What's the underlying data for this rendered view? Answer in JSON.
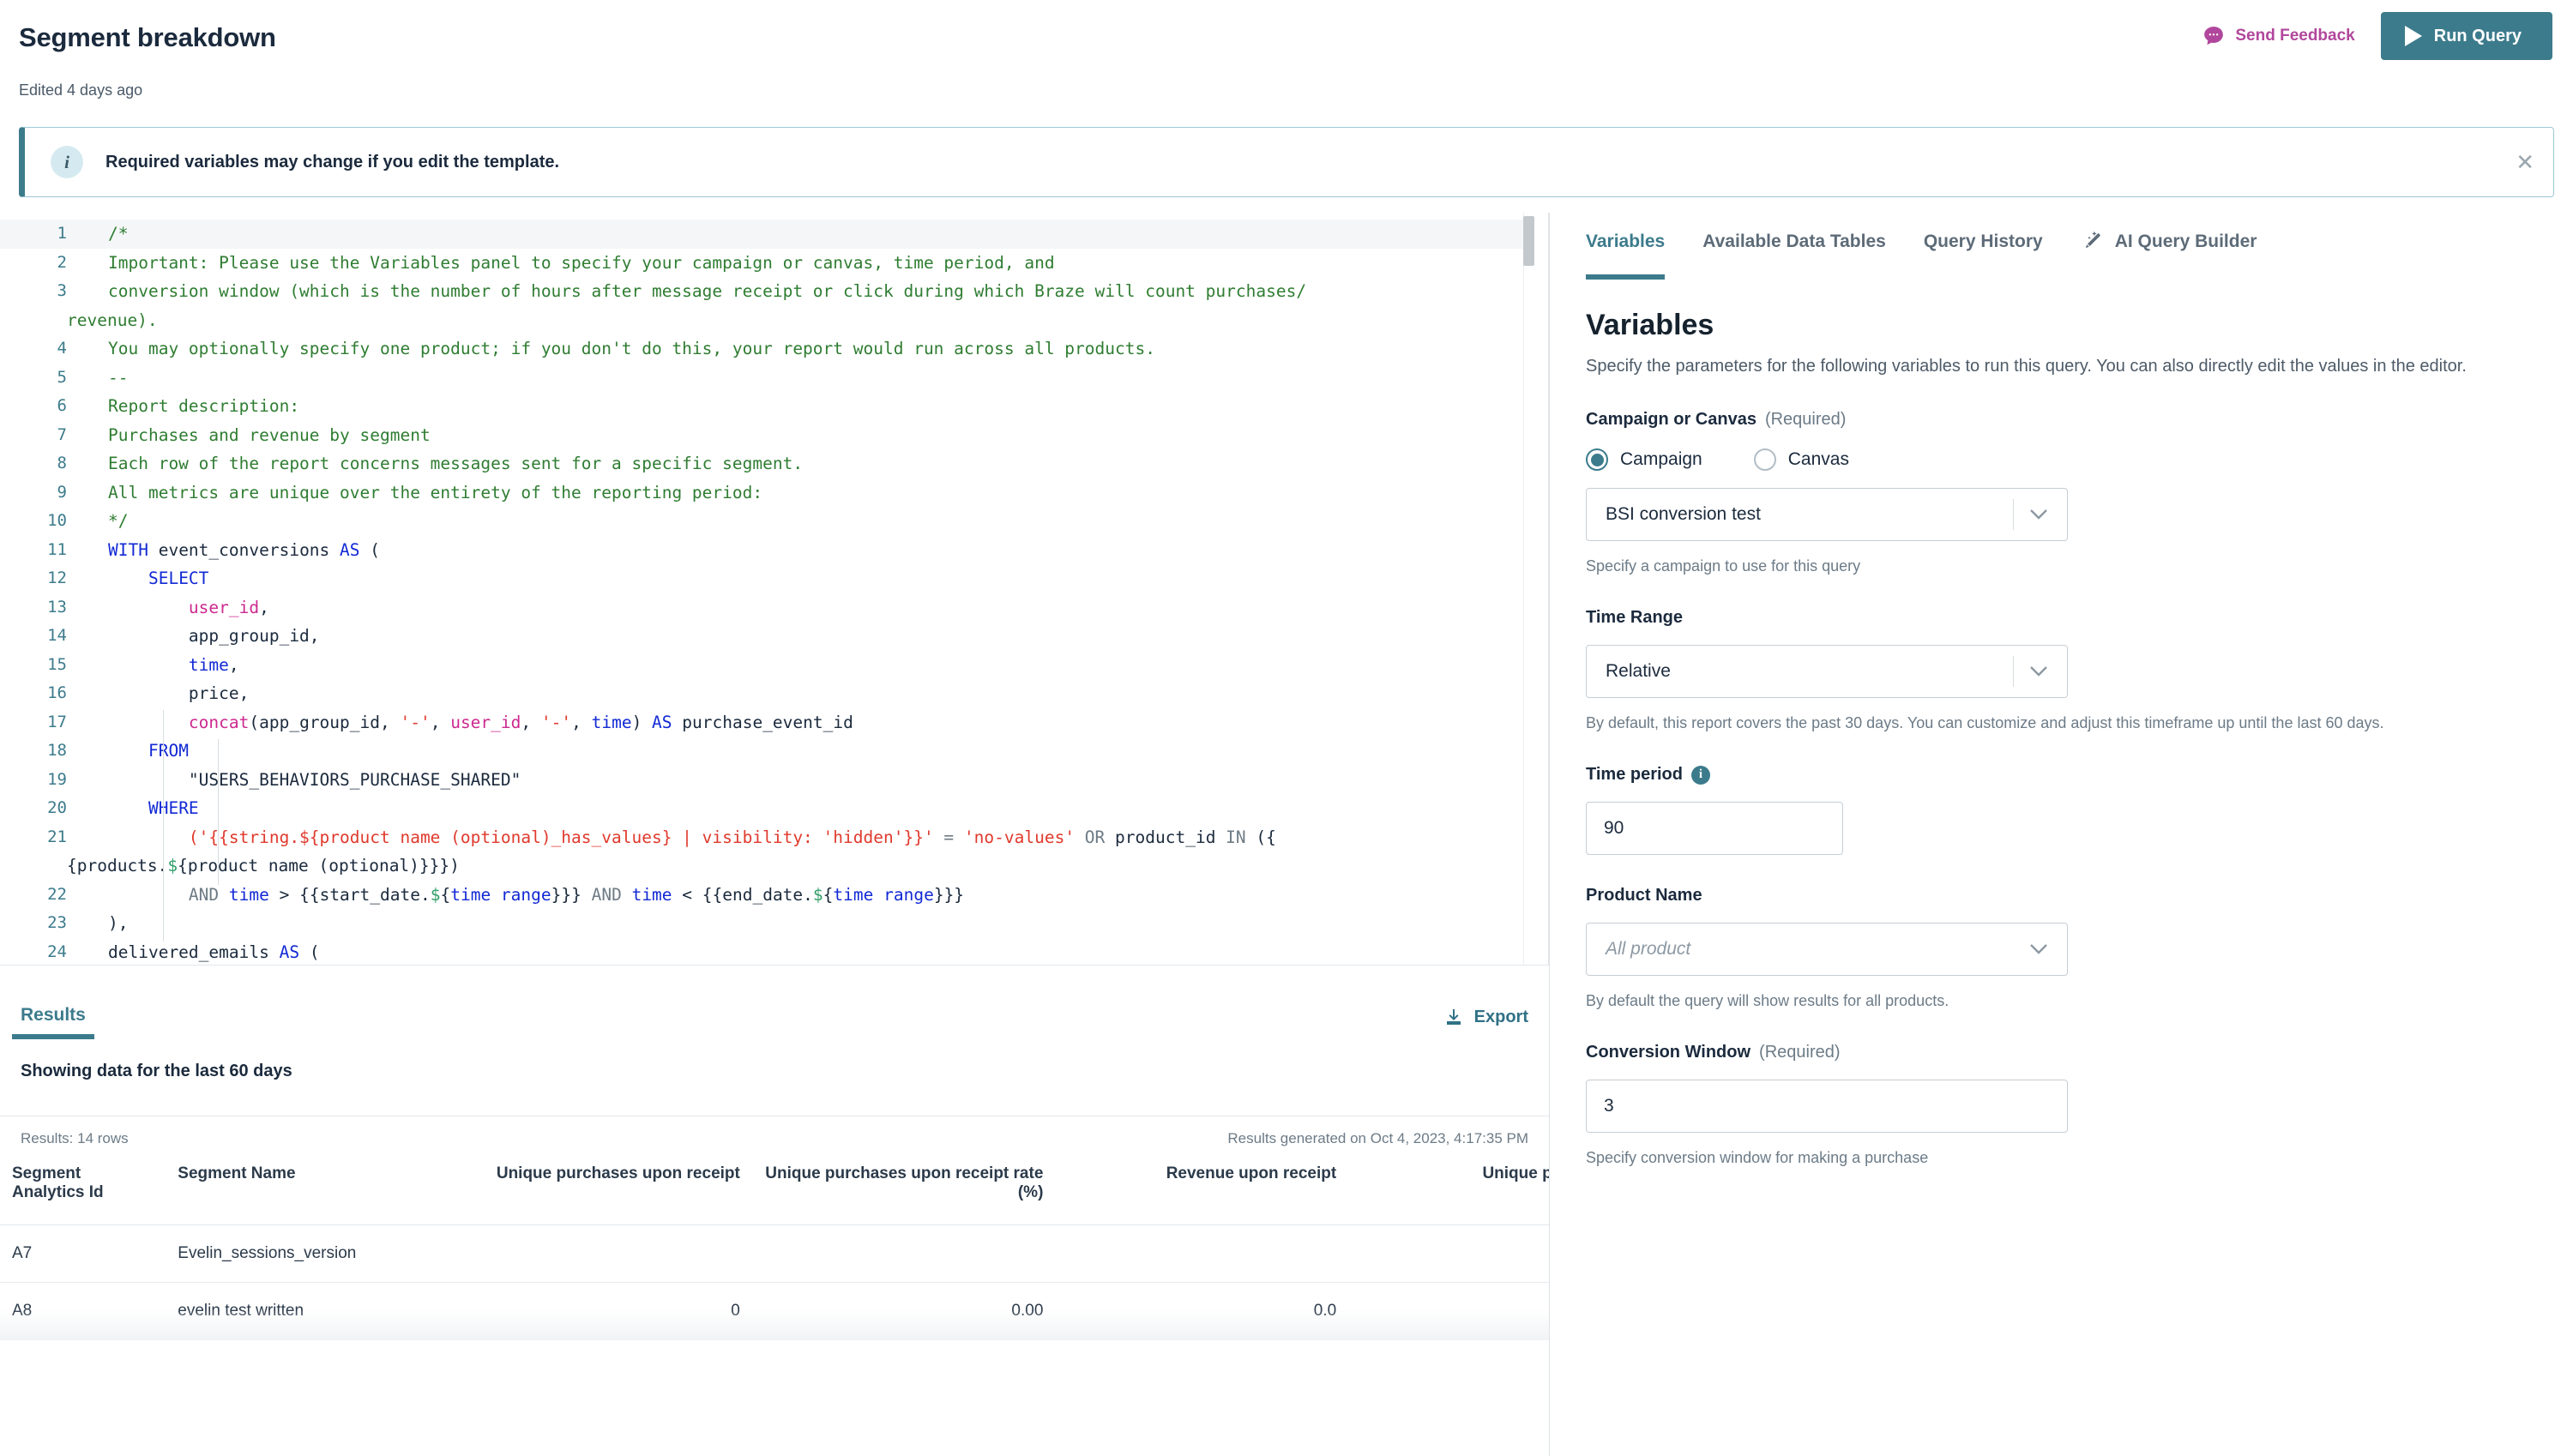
{
  "header": {
    "title": "Segment breakdown",
    "subtitle": "Edited 4 days ago",
    "send_feedback_label": "Send Feedback",
    "run_query_label": "Run Query"
  },
  "banner": {
    "icon": "info-icon",
    "text": "Required variables may change if you edit the template.",
    "close_label": "✕"
  },
  "editor": {
    "lines": [
      {
        "n": "1",
        "active": true,
        "segments": [
          {
            "t": "/*",
            "c": "cm"
          }
        ]
      },
      {
        "n": "2",
        "segments": [
          {
            "t": "Important: Please use the Variables panel to specify your campaign or canvas, time period, and",
            "c": "cm"
          }
        ]
      },
      {
        "n": "3",
        "segments": [
          {
            "t": "conversion window (which is the number of hours after message receipt or click during which Braze will count purchases/",
            "c": "cm"
          }
        ]
      },
      {
        "n": "",
        "cont": true,
        "segments": [
          {
            "t": "revenue).",
            "c": "cm"
          }
        ]
      },
      {
        "n": "4",
        "segments": [
          {
            "t": "You may optionally specify one product; if you don't do this, your report would run across all products.",
            "c": "cm"
          }
        ]
      },
      {
        "n": "5",
        "segments": [
          {
            "t": "--",
            "c": "cm"
          }
        ]
      },
      {
        "n": "6",
        "segments": [
          {
            "t": "Report description:",
            "c": "cm"
          }
        ]
      },
      {
        "n": "7",
        "segments": [
          {
            "t": "Purchases and revenue by segment",
            "c": "cm"
          }
        ]
      },
      {
        "n": "8",
        "segments": [
          {
            "t": "Each row of the report concerns messages sent for a specific segment.",
            "c": "cm"
          }
        ]
      },
      {
        "n": "9",
        "segments": [
          {
            "t": "All metrics are unique over the entirety of the reporting period:",
            "c": "cm"
          }
        ]
      },
      {
        "n": "10",
        "segments": [
          {
            "t": "*/",
            "c": "cm"
          }
        ]
      },
      {
        "n": "11",
        "segments": [
          {
            "t": "WITH",
            "c": "kw"
          },
          {
            "t": " event_conversions ",
            "c": "pl"
          },
          {
            "t": "AS",
            "c": "kw"
          },
          {
            "t": " (",
            "c": "pl"
          }
        ]
      },
      {
        "n": "12",
        "segments": [
          {
            "t": "    ",
            "c": "pl"
          },
          {
            "t": "SELECT",
            "c": "kw"
          }
        ]
      },
      {
        "n": "13",
        "segments": [
          {
            "t": "        ",
            "c": "pl"
          },
          {
            "t": "user_id",
            "c": "fn"
          },
          {
            "t": ",",
            "c": "pl"
          }
        ]
      },
      {
        "n": "14",
        "segments": [
          {
            "t": "        app_group_id,",
            "c": "pl"
          }
        ]
      },
      {
        "n": "15",
        "segments": [
          {
            "t": "        ",
            "c": "pl"
          },
          {
            "t": "time",
            "c": "kw"
          },
          {
            "t": ",",
            "c": "pl"
          }
        ]
      },
      {
        "n": "16",
        "segments": [
          {
            "t": "        price,",
            "c": "pl"
          }
        ]
      },
      {
        "n": "17",
        "segments": [
          {
            "t": "        ",
            "c": "pl"
          },
          {
            "t": "concat",
            "c": "fn"
          },
          {
            "t": "(app_group_id, ",
            "c": "pl"
          },
          {
            "t": "'-'",
            "c": "st"
          },
          {
            "t": ", ",
            "c": "pl"
          },
          {
            "t": "user_id",
            "c": "fn"
          },
          {
            "t": ", ",
            "c": "pl"
          },
          {
            "t": "'-'",
            "c": "st"
          },
          {
            "t": ", ",
            "c": "pl"
          },
          {
            "t": "time",
            "c": "kw"
          },
          {
            "t": ") ",
            "c": "pl"
          },
          {
            "t": "AS",
            "c": "kw"
          },
          {
            "t": " purchase_event_id",
            "c": "pl"
          }
        ]
      },
      {
        "n": "18",
        "segments": [
          {
            "t": "    ",
            "c": "pl"
          },
          {
            "t": "FROM",
            "c": "kw"
          }
        ]
      },
      {
        "n": "19",
        "segments": [
          {
            "t": "        \"USERS_BEHAVIORS_PURCHASE_SHARED\"",
            "c": "pl"
          }
        ]
      },
      {
        "n": "20",
        "segments": [
          {
            "t": "    ",
            "c": "pl"
          },
          {
            "t": "WHERE",
            "c": "kw"
          }
        ]
      },
      {
        "n": "21",
        "segments": [
          {
            "t": "        ",
            "c": "pl"
          },
          {
            "t": "('{{string.${product name (optional)_has_values} | visibility: 'hidden'}}'",
            "c": "st"
          },
          {
            "t": " = ",
            "c": "op"
          },
          {
            "t": "'no-values'",
            "c": "st"
          },
          {
            "t": " OR ",
            "c": "op"
          },
          {
            "t": "product_id ",
            "c": "pl"
          },
          {
            "t": "IN",
            "c": "op"
          },
          {
            "t": " ({",
            "c": "pl"
          }
        ]
      },
      {
        "n": "",
        "cont": true,
        "segments": [
          {
            "t": "{products.",
            "c": "pl"
          },
          {
            "t": "$",
            "c": "gr"
          },
          {
            "t": "{product name (optional)}}})",
            "c": "pl"
          }
        ]
      },
      {
        "n": "22",
        "segments": [
          {
            "t": "        ",
            "c": "pl"
          },
          {
            "t": "AND",
            "c": "op"
          },
          {
            "t": " ",
            "c": "pl"
          },
          {
            "t": "time",
            "c": "kw"
          },
          {
            "t": " > {{start_date.",
            "c": "pl"
          },
          {
            "t": "$",
            "c": "gr"
          },
          {
            "t": "{",
            "c": "pl"
          },
          {
            "t": "time range",
            "c": "kw"
          },
          {
            "t": "}}} ",
            "c": "pl"
          },
          {
            "t": "AND",
            "c": "op"
          },
          {
            "t": " ",
            "c": "pl"
          },
          {
            "t": "time",
            "c": "kw"
          },
          {
            "t": " < {{end_date.",
            "c": "pl"
          },
          {
            "t": "$",
            "c": "gr"
          },
          {
            "t": "{",
            "c": "pl"
          },
          {
            "t": "time range",
            "c": "kw"
          },
          {
            "t": "}}}",
            "c": "pl"
          }
        ]
      },
      {
        "n": "23",
        "segments": [
          {
            "t": "),",
            "c": "pl"
          }
        ]
      },
      {
        "n": "24",
        "segments": [
          {
            "t": "delivered_emails ",
            "c": "pl"
          },
          {
            "t": "AS",
            "c": "kw"
          },
          {
            "t": " (",
            "c": "pl"
          }
        ]
      }
    ]
  },
  "results": {
    "tab_label": "Results",
    "export_label": "Export",
    "showing_data": "Showing data for the last 60 days",
    "row_count": "Results: 14 rows",
    "generated": "Results generated on Oct 4, 2023, 4:17:35 PM",
    "columns": [
      "Segment Analytics Id",
      "Segment Name",
      "Unique purchases upon receipt",
      "Unique purchases upon receipt rate (%)",
      "Revenue upon receipt",
      "Unique purchases upon cl"
    ],
    "rows": [
      {
        "cells": [
          "A7",
          "Evelin_sessions_version",
          "",
          "",
          "",
          ""
        ]
      },
      {
        "cells": [
          "A8",
          "evelin test written",
          "0",
          "0.00",
          "0.0",
          ""
        ]
      }
    ]
  },
  "panel": {
    "tabs": [
      {
        "label": "Variables",
        "selected": true,
        "icon": null
      },
      {
        "label": "Available Data Tables",
        "selected": false,
        "icon": null
      },
      {
        "label": "Query History",
        "selected": false,
        "icon": null
      },
      {
        "label": "AI Query Builder",
        "selected": false,
        "icon": "magic-wand-icon"
      }
    ],
    "title": "Variables",
    "description": "Specify the parameters for the following variables to run this query. You can also directly edit the values in the editor.",
    "fields": {
      "campaign_or_canvas": {
        "label": "Campaign or Canvas",
        "required_tag": "(Required)",
        "radio_campaign": "Campaign",
        "radio_canvas": "Canvas",
        "selected": "Campaign",
        "select_value": "BSI conversion test",
        "hint": "Specify a campaign to use for this query"
      },
      "time_range": {
        "label": "Time Range",
        "select_value": "Relative",
        "hint": "By default, this report covers the past 30 days. You can customize and adjust this timeframe up until the last 60 days."
      },
      "time_period": {
        "label": "Time period",
        "info_icon": "info-icon",
        "value": "90"
      },
      "product_name": {
        "label": "Product Name",
        "placeholder": "All product",
        "hint": "By default the query will show results for all products."
      },
      "conversion_window": {
        "label": "Conversion Window",
        "required_tag": "(Required)",
        "value": "3",
        "hint": "Specify conversion window for making a purchase"
      }
    }
  },
  "colors": {
    "accent": "#3c7b8c",
    "feedback": "#b1479c",
    "text": "#1b2a3d",
    "muted": "#6c7b87"
  }
}
